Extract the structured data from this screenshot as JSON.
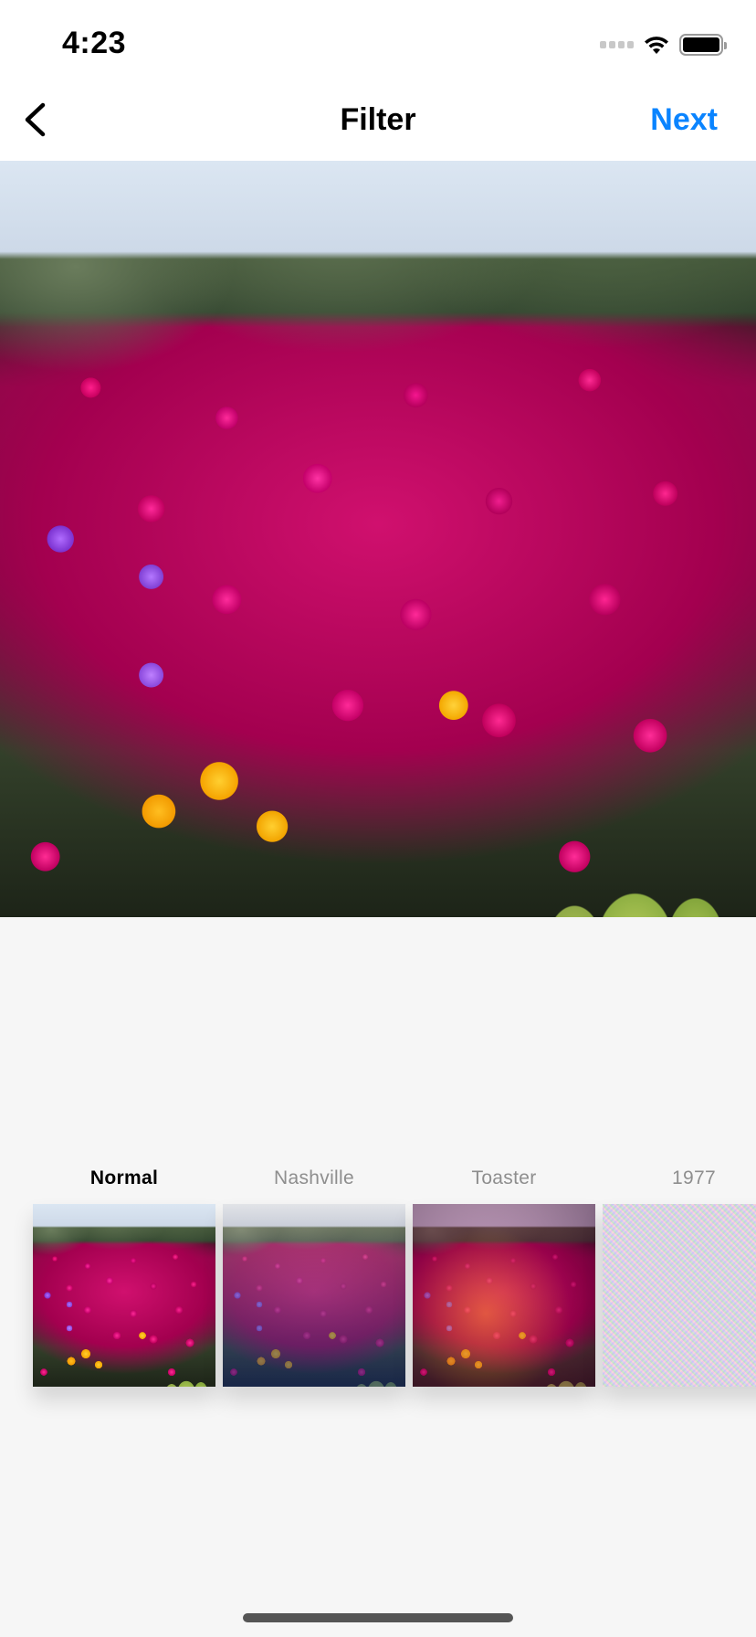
{
  "status_bar": {
    "time": "4:23",
    "signal_icon": "cellular-signal-icon",
    "wifi_icon": "wifi-icon",
    "battery_icon": "battery-icon"
  },
  "nav": {
    "back_icon": "chevron-left-icon",
    "title": "Filter",
    "next_label": "Next",
    "accent_color": "#0a84ff"
  },
  "photo": {
    "description": "Field of magenta, purple and yellow ice plant flowers with shrubs behind"
  },
  "filters": {
    "selected": "Normal",
    "items": [
      {
        "label": "Normal",
        "selected": true
      },
      {
        "label": "Nashville",
        "selected": false
      },
      {
        "label": "Toaster",
        "selected": false
      },
      {
        "label": "1977",
        "selected": false
      }
    ]
  }
}
